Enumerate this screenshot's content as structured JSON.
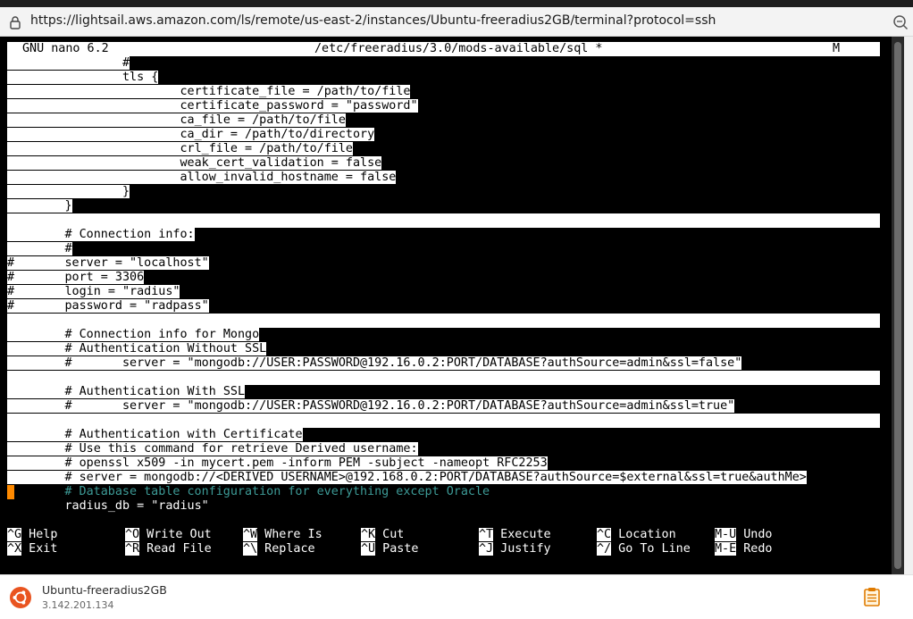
{
  "browser": {
    "url": "https://lightsail.aws.amazon.com/ls/remote/us-east-2/instances/Ubuntu-freeradius2GB/terminal?protocol=ssh"
  },
  "nano": {
    "version": "GNU nano 6.2",
    "file": "/etc/freeradius/3.0/mods-available/sql *",
    "flag": "M"
  },
  "lines": [
    "\t\t#",
    "\t\ttls {",
    "\t\t\tcertificate_file = /path/to/file",
    "\t\t\tcertificate_password = \"password\"",
    "\t\t\tca_file = /path/to/file",
    "\t\t\tca_dir = /path/to/directory",
    "\t\t\tcrl_file = /path/to/file",
    "\t\t\tweak_cert_validation = false",
    "\t\t\tallow_invalid_hostname = false",
    "\t\t}",
    "\t}",
    "",
    "\t# Connection info:",
    "\t#",
    "#\tserver = \"localhost\"",
    "#\tport = 3306",
    "#\tlogin = \"radius\"",
    "#\tpassword = \"radpass\"",
    "",
    "\t# Connection info for Mongo",
    "\t# Authentication Without SSL",
    "\t#\tserver = \"mongodb://USER:PASSWORD@192.16.0.2:PORT/DATABASE?authSource=admin&ssl=false\"",
    "",
    "\t# Authentication With SSL",
    "\t#\tserver = \"mongodb://USER:PASSWORD@192.16.0.2:PORT/DATABASE?authSource=admin&ssl=true\"",
    "",
    "\t# Authentication with Certificate",
    "\t# Use this command for retrieve Derived username:",
    "\t# openssl x509 -in mycert.pem -inform PEM -subject -nameopt RFC2253",
    "\t# server = mongodb://<DERIVED USERNAME>@192.168.0.2:PORT/DATABASE?authSource=$external&ssl=true&authMe>",
    "\t# Database table configuration for everything except Oracle",
    "\tradius_db = \"radius\""
  ],
  "shortcuts_row1": [
    {
      "key": "^G",
      "label": "Help"
    },
    {
      "key": "^O",
      "label": "Write Out"
    },
    {
      "key": "^W",
      "label": "Where Is"
    },
    {
      "key": "^K",
      "label": "Cut"
    },
    {
      "key": "^T",
      "label": "Execute"
    },
    {
      "key": "^C",
      "label": "Location"
    },
    {
      "key": "M-U",
      "label": "Undo"
    }
  ],
  "shortcuts_row2": [
    {
      "key": "^X",
      "label": "Exit"
    },
    {
      "key": "^R",
      "label": "Read File"
    },
    {
      "key": "^\\",
      "label": "Replace"
    },
    {
      "key": "^U",
      "label": "Paste"
    },
    {
      "key": "^J",
      "label": "Justify"
    },
    {
      "key": "^/",
      "label": "Go To Line"
    },
    {
      "key": "M-E",
      "label": "Redo"
    }
  ],
  "instance": {
    "name": "Ubuntu-freeradius2GB",
    "ip": "3.142.201.134"
  },
  "colors": {
    "terminal_bg": "#000000",
    "highlight_bg": "#ffffff",
    "comment_cyan": "#3d9a96",
    "cursor": "#ff8a00",
    "ubuntu_orange": "#e95420"
  }
}
